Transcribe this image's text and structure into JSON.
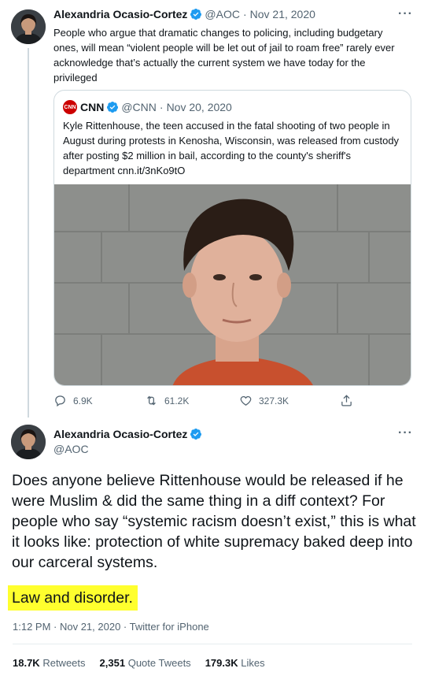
{
  "thread_tweet": {
    "author_name": "Alexandria Ocasio-Cortez",
    "handle": "@AOC",
    "separator": "·",
    "date": "Nov 21, 2020",
    "text": "People who argue that dramatic changes to policing, including budgetary ones, will mean “violent people will be let out of jail to roam free” rarely ever acknowledge that’s actually the current system we have today for the privileged",
    "more_glyph": "···"
  },
  "quoted_tweet": {
    "logo_text": "CNN",
    "author_name": "CNN",
    "handle": "@CNN",
    "separator": "·",
    "date": "Nov 20, 2020",
    "text": "Kyle Rittenhouse, the teen accused in the fatal shooting of two people in August during protests in Kenosha, Wisconsin, was released from custody after posting $2 million in bail, according to the county's sheriff's department cnn.it/3nKo9tO"
  },
  "actions": {
    "replies": "6.9K",
    "retweets": "61.2K",
    "likes": "327.3K"
  },
  "main_tweet": {
    "author_name": "Alexandria Ocasio-Cortez",
    "handle": "@AOC",
    "more_glyph": "···",
    "text": "Does anyone believe Rittenhouse would be released if he were Muslim & did the same thing in a diff context? For people who say “systemic racism doesn’t exist,” this is what it looks like: protection of white supremacy baked deep into our carceral systems.",
    "highlight": "Law and disorder.",
    "meta": "1:12 PM · Nov 21, 2020 · Twitter for iPhone"
  },
  "stats": {
    "retweets_count": "18.7K",
    "retweets_label": "Retweets",
    "quotes_count": "2,351",
    "quotes_label": "Quote Tweets",
    "likes_count": "179.3K",
    "likes_label": "Likes"
  },
  "colors": {
    "verified": "#1d9bf0",
    "highlight": "#ffff2e",
    "muted": "#536471",
    "cnn_red": "#cc0000"
  }
}
